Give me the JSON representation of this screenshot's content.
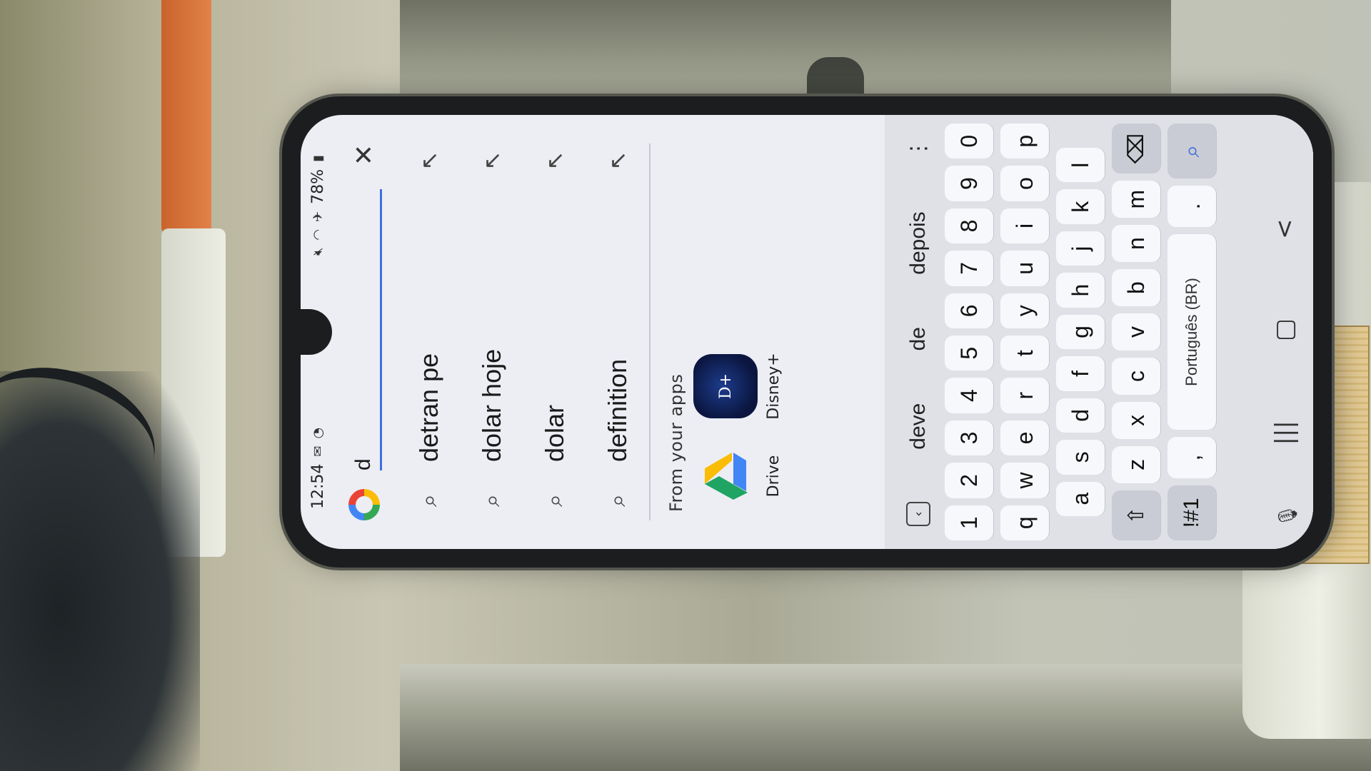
{
  "status": {
    "time": "12:54",
    "battery": "78%",
    "left_icons": [
      "mail-icon",
      "sync-icon"
    ],
    "right_icons": [
      "mute-icon",
      "wifi-icon",
      "airplane-icon",
      "battery-icon"
    ]
  },
  "search": {
    "query": "d",
    "close_label": "✕"
  },
  "suggestions": [
    {
      "text": "detran pe"
    },
    {
      "text": "dolar hoje"
    },
    {
      "text": "dolar"
    },
    {
      "text": "definition"
    }
  ],
  "apps": {
    "title": "From your apps",
    "items": [
      {
        "label": "Drive"
      },
      {
        "label": "Disney+"
      }
    ]
  },
  "keyboard": {
    "predictions": [
      "deve",
      "de",
      "depois"
    ],
    "more_label": "⋮",
    "numbers": [
      "1",
      "2",
      "3",
      "4",
      "5",
      "6",
      "7",
      "8",
      "9",
      "0"
    ],
    "row1": [
      "q",
      "w",
      "e",
      "r",
      "t",
      "y",
      "u",
      "i",
      "o",
      "p"
    ],
    "row2": [
      "a",
      "s",
      "d",
      "f",
      "g",
      "h",
      "j",
      "k",
      "l"
    ],
    "row3": [
      "z",
      "x",
      "c",
      "v",
      "b",
      "n",
      "m"
    ],
    "symbols_label": "!#1",
    "comma_label": ",",
    "space_label": "Português (BR)",
    "period_label": "."
  },
  "nav": {
    "recents": "|||",
    "home": "▢",
    "back": "<"
  }
}
